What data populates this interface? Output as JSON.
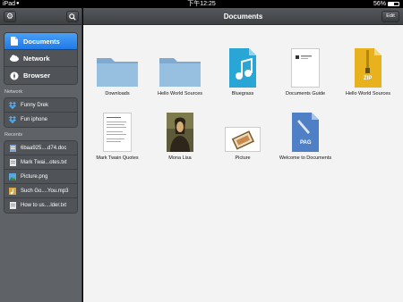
{
  "status_bar": {
    "carrier": "iPad",
    "time": "下午12:25",
    "battery": "56%"
  },
  "sidebar": {
    "nav": [
      {
        "label": "Documents",
        "icon": "document-icon",
        "active": true
      },
      {
        "label": "Network",
        "icon": "cloud-icon",
        "active": false
      },
      {
        "label": "Browser",
        "icon": "compass-icon",
        "active": false
      }
    ],
    "network_label": "Network",
    "network": [
      {
        "label": "Funny Drek",
        "icon": "dropbox-icon"
      },
      {
        "label": "Fun iphone",
        "icon": "dropbox-icon"
      }
    ],
    "recents_label": "Recents",
    "recents": [
      {
        "label": "6baa925....d74.doc",
        "icon": "doc-file-icon"
      },
      {
        "label": "Mark Twai...otes.txt",
        "icon": "text-file-icon"
      },
      {
        "label": "Picture.png",
        "icon": "image-file-icon"
      },
      {
        "label": "Such Go....You.mp3",
        "icon": "audio-file-icon"
      },
      {
        "label": "How to us....lder.txt",
        "icon": "text-file-icon"
      }
    ]
  },
  "main": {
    "title": "Documents",
    "edit_label": "Edit",
    "items": [
      {
        "label": "Downloads",
        "kind": "folder"
      },
      {
        "label": "Hello World Sources",
        "kind": "folder"
      },
      {
        "label": "Bluegrass",
        "kind": "music"
      },
      {
        "label": "Documents Guide",
        "kind": "pdf-doc"
      },
      {
        "label": "Hello World Sources",
        "kind": "zip",
        "badge": "ZIP"
      },
      {
        "label": "Mark Twain Quotes",
        "kind": "text"
      },
      {
        "label": "Mona Lisa",
        "kind": "painting"
      },
      {
        "label": "Picture",
        "kind": "picture"
      },
      {
        "label": "Welcome to Documents",
        "kind": "pages",
        "badge": "PAG"
      }
    ]
  },
  "colors": {
    "accent": "#2a86ee",
    "sidebar_bg": "#5f6266",
    "main_bg": "#f3f3f3",
    "folder": "#8fb7d8",
    "music_bg": "#2aa6d6",
    "zip_bg": "#e8b21e",
    "pages_bg": "#4f7fc4"
  }
}
